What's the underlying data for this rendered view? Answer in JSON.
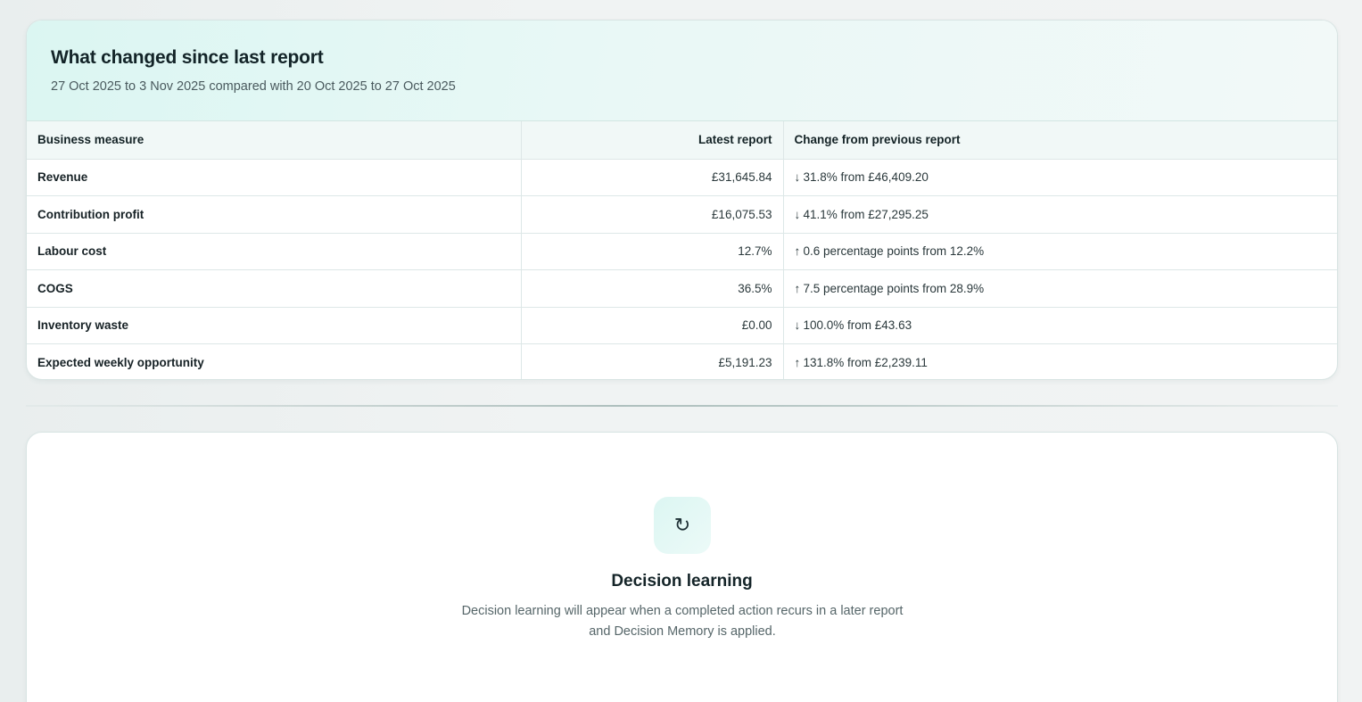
{
  "changes": {
    "title": "What changed since last report",
    "subtitle": "27 Oct 2025 to 3 Nov 2025 compared with 20 Oct 2025 to 27 Oct 2025",
    "columns": {
      "measure": "Business measure",
      "latest": "Latest report",
      "change": "Change from previous report"
    },
    "rows": [
      {
        "measure": "Revenue",
        "latest": "£31,645.84",
        "direction": "down",
        "arrow": "↓",
        "change": "31.8% from £46,409.20"
      },
      {
        "measure": "Contribution profit",
        "latest": "£16,075.53",
        "direction": "down",
        "arrow": "↓",
        "change": "41.1% from £27,295.25"
      },
      {
        "measure": "Labour cost",
        "latest": "12.7%",
        "direction": "up",
        "arrow": "↑",
        "change": "0.6 percentage points from 12.2%"
      },
      {
        "measure": "COGS",
        "latest": "36.5%",
        "direction": "up",
        "arrow": "↑",
        "change": "7.5 percentage points from 28.9%"
      },
      {
        "measure": "Inventory waste",
        "latest": "£0.00",
        "direction": "down",
        "arrow": "↓",
        "change": "100.0% from £43.63"
      },
      {
        "measure": "Expected weekly opportunity",
        "latest": "£5,191.23",
        "direction": "up",
        "arrow": "↑",
        "change": "131.8% from £2,239.11"
      }
    ]
  },
  "learning": {
    "icon": "refresh-icon",
    "icon_glyph": "↻",
    "title": "Decision learning",
    "line1": "Decision learning will appear when a completed action recurs in a later report",
    "line2": "and Decision Memory is applied."
  },
  "colors": {
    "accent_tint": "#dbf6f2",
    "heading": "#132428",
    "muted_text": "#4a5a5e",
    "border": "#d8e4e3"
  }
}
